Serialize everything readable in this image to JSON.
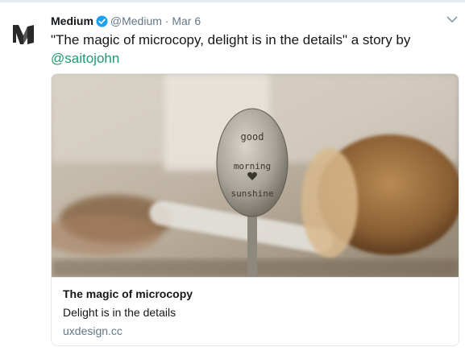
{
  "tweet": {
    "author_name": "Medium",
    "author_handle": "@Medium",
    "separator": "·",
    "date": "Mar 6",
    "text": "\"The magic of microcopy, delight is in the details\" a story by",
    "mention": "@saitojohn"
  },
  "card": {
    "image_words": [
      "good",
      "morning",
      "sunshine"
    ],
    "title": "The magic of microcopy",
    "description": "Delight is in the details",
    "domain": "uxdesign.cc"
  },
  "colors": {
    "verified_badge": "#1da1f2",
    "mention": "#1d9b6b",
    "muted_text": "#657786",
    "border": "#e1e8ed"
  },
  "icons": {
    "avatar": "medium-logo-icon",
    "verified": "verified-badge-icon",
    "menu": "chevron-down-icon"
  }
}
